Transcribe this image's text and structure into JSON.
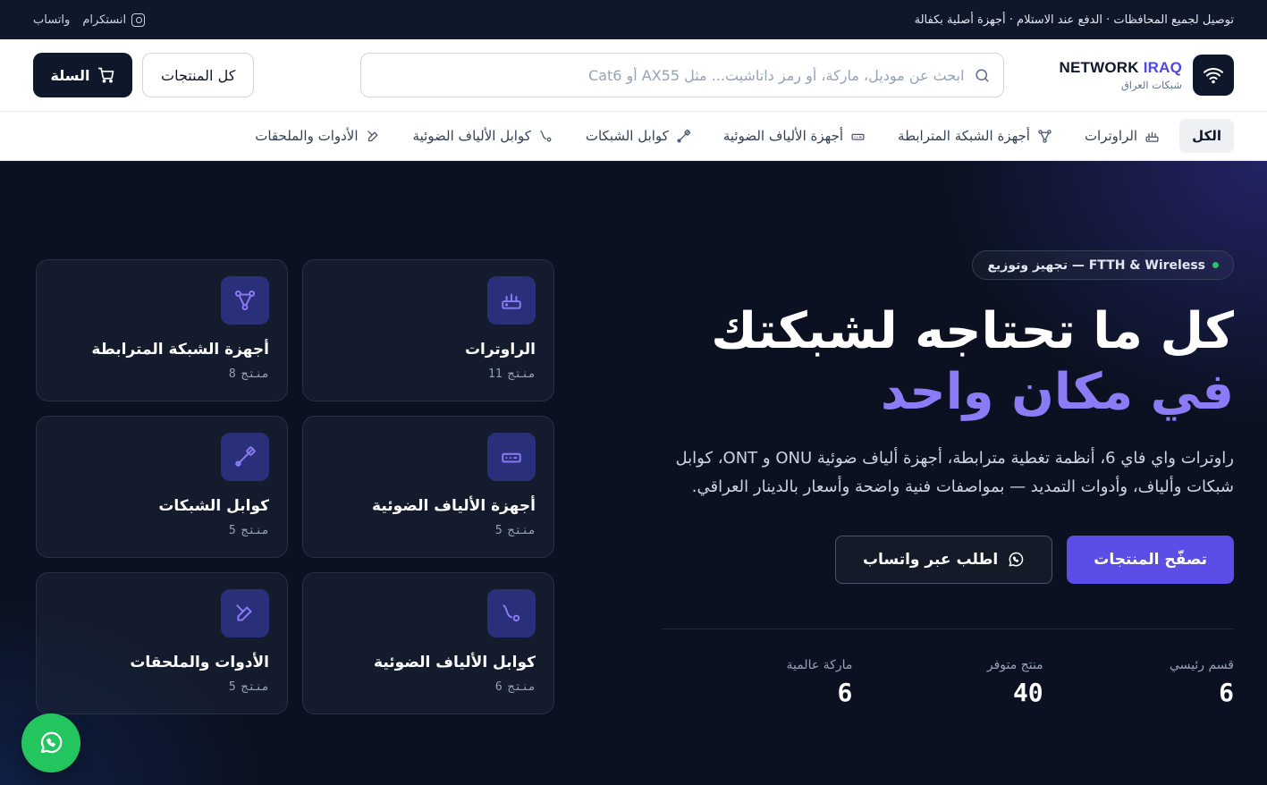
{
  "topbar": {
    "notice": "توصيل لجميع المحافظات · الدفع عند الاستلام · أجهزة أصلية بكفالة",
    "instagram_label": "انستكرام",
    "whatsapp_label": "واتساب"
  },
  "brand": {
    "name_part1": "NETWORK",
    "name_part2": "IRAQ",
    "subtitle": "شبكات العراق"
  },
  "search": {
    "placeholder": "ابحث عن موديل، ماركة، أو رمز داتاشيت... مثل AX55 أو Cat6"
  },
  "header": {
    "all_products_label": "كل المنتجات",
    "cart_label": "السلة"
  },
  "nav": {
    "items": [
      {
        "label": "الكل"
      },
      {
        "label": "الراوترات",
        "icon": "router-icon"
      },
      {
        "label": "أجهزة الشبكة المترابطة",
        "icon": "mesh-icon"
      },
      {
        "label": "أجهزة الألياف الضوئية",
        "icon": "fiber-device-icon"
      },
      {
        "label": "كوابل الشبكات",
        "icon": "cable-icon"
      },
      {
        "label": "كوابل الألياف الضوئية",
        "icon": "fiber-cable-icon"
      },
      {
        "label": "الأدوات والملحقات",
        "icon": "tools-icon"
      }
    ]
  },
  "hero": {
    "pill": "FTTH & Wireless — تجهيز وتوزيع",
    "title_line1": "كل ما تحتاجه لشبكتك",
    "title_line2": "في مكان واحد",
    "lead": "راوترات واي فاي 6، أنظمة تغطية مترابطة، أجهزة ألياف ضوئية ONU و ONT، كوابل شبكات وألياف، وأدوات التمديد — بمواصفات فنية واضحة وأسعار بالدينار العراقي.",
    "primary_cta": "تصفّح المنتجات",
    "secondary_cta": "اطلب عبر واتساب",
    "stats": [
      {
        "label": "قسم رئيسي",
        "value": "6"
      },
      {
        "label": "منتج متوفر",
        "value": "40"
      },
      {
        "label": "ماركة عالمية",
        "value": "6"
      }
    ]
  },
  "cards": {
    "unit": "منتج",
    "items": [
      {
        "title": "الراوترات",
        "count": "11",
        "icon": "router-icon"
      },
      {
        "title": "أجهزة الشبكة المترابطة",
        "count": "8",
        "icon": "mesh-icon"
      },
      {
        "title": "أجهزة الألياف الضوئية",
        "count": "5",
        "icon": "fiber-device-icon"
      },
      {
        "title": "كوابل الشبكات",
        "count": "5",
        "icon": "cable-icon"
      },
      {
        "title": "كوابل الألياف الضوئية",
        "count": "6",
        "icon": "fiber-cable-icon"
      },
      {
        "title": "الأدوات والملحقات",
        "count": "5",
        "icon": "tools-icon"
      }
    ]
  },
  "colors": {
    "accent": "#5b4ee6",
    "accent_text": "#8b7cf6",
    "dark": "#0f172a",
    "whatsapp": "#22c55e"
  }
}
